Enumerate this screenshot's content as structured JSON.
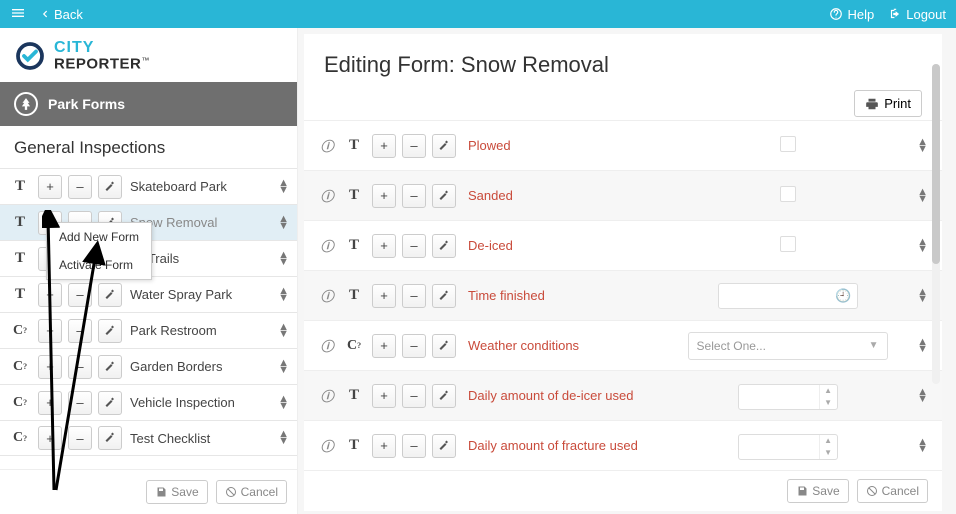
{
  "topbar": {
    "back": "Back",
    "help": "Help",
    "logout": "Logout"
  },
  "brand": {
    "line1": "CITY",
    "line2": "REPORTER",
    "tm": "™"
  },
  "category": "Park Forms",
  "section": "General Inspections",
  "forms": [
    {
      "type": "T",
      "label": "Skateboard Park",
      "selected": false
    },
    {
      "type": "T",
      "label": "Snow Removal",
      "selected": true
    },
    {
      "type": "T",
      "label": "ng Trails",
      "selected": false
    },
    {
      "type": "T",
      "label": "Water Spray Park",
      "selected": false
    },
    {
      "type": "Cq",
      "label": "Park Restroom",
      "selected": false
    },
    {
      "type": "Cq",
      "label": "Garden Borders",
      "selected": false
    },
    {
      "type": "Cq",
      "label": "Vehicle Inspection",
      "selected": false
    },
    {
      "type": "Cq",
      "label": "Test Checklist",
      "selected": false
    }
  ],
  "context_menu": [
    "Add New Form",
    "Activate Form"
  ],
  "buttons": {
    "save": "Save",
    "cancel": "Cancel",
    "print": "Print"
  },
  "editing": {
    "title": "Editing Form: Snow Removal",
    "fields": [
      {
        "type": "T",
        "label": "Plowed",
        "control": "checkbox"
      },
      {
        "type": "T",
        "label": "Sanded",
        "control": "checkbox"
      },
      {
        "type": "T",
        "label": "De-iced",
        "control": "checkbox"
      },
      {
        "type": "T",
        "label": "Time finished",
        "control": "time"
      },
      {
        "type": "Cq",
        "label": "Weather conditions",
        "control": "select",
        "placeholder": "Select One..."
      },
      {
        "type": "T",
        "label": "Daily amount of de-icer used",
        "control": "number"
      },
      {
        "type": "T",
        "label": "Daily amount of fracture used",
        "control": "number"
      }
    ]
  }
}
